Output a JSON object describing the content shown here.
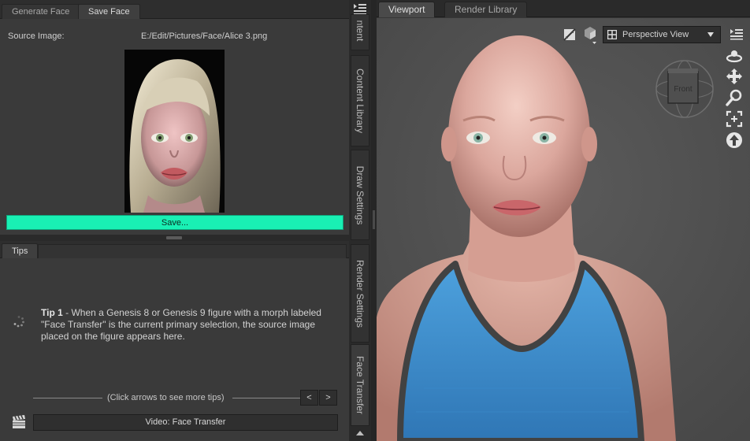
{
  "left_pane": {
    "tabs": [
      {
        "label": "Generate Face",
        "active": false
      },
      {
        "label": "Save Face",
        "active": true
      }
    ],
    "source_image_label": "Source Image:",
    "source_image_path": "E:/Edit/Pictures/Face/Alice 3.png",
    "save_button_label": "Save...",
    "save_button_color": "#19f0b4"
  },
  "tips_panel": {
    "tab_label": "Tips",
    "tip_title": "Tip 1",
    "tip_body": " - When a Genesis 8 or Genesis 9 figure with a morph labeled \"Face Transfer\" is the current primary selection, the source image placed on the figure appears here.",
    "hint": "(Click arrows to see more tips)",
    "prev_label": "<",
    "next_label": ">",
    "video_button_label": "Video: Face Transfer"
  },
  "side_tabs": [
    {
      "label": "ntent",
      "active": false
    },
    {
      "label": "Content Library",
      "active": false
    },
    {
      "label": "Draw Settings",
      "active": false
    },
    {
      "label": "Render Settings",
      "active": false
    },
    {
      "label": "Face Transfer",
      "active": true
    }
  ],
  "viewport_pane": {
    "tabs": [
      {
        "label": "Viewport",
        "active": true
      },
      {
        "label": "Render Library",
        "active": false
      }
    ],
    "camera_label": "Perspective View",
    "view_cube_label": "Front",
    "icons": [
      "draw-style-icon",
      "shading-icon",
      "camera-icon",
      "menu-icon",
      "orbit-icon",
      "pan-icon",
      "zoom-icon",
      "frame-icon",
      "up-icon"
    ]
  }
}
